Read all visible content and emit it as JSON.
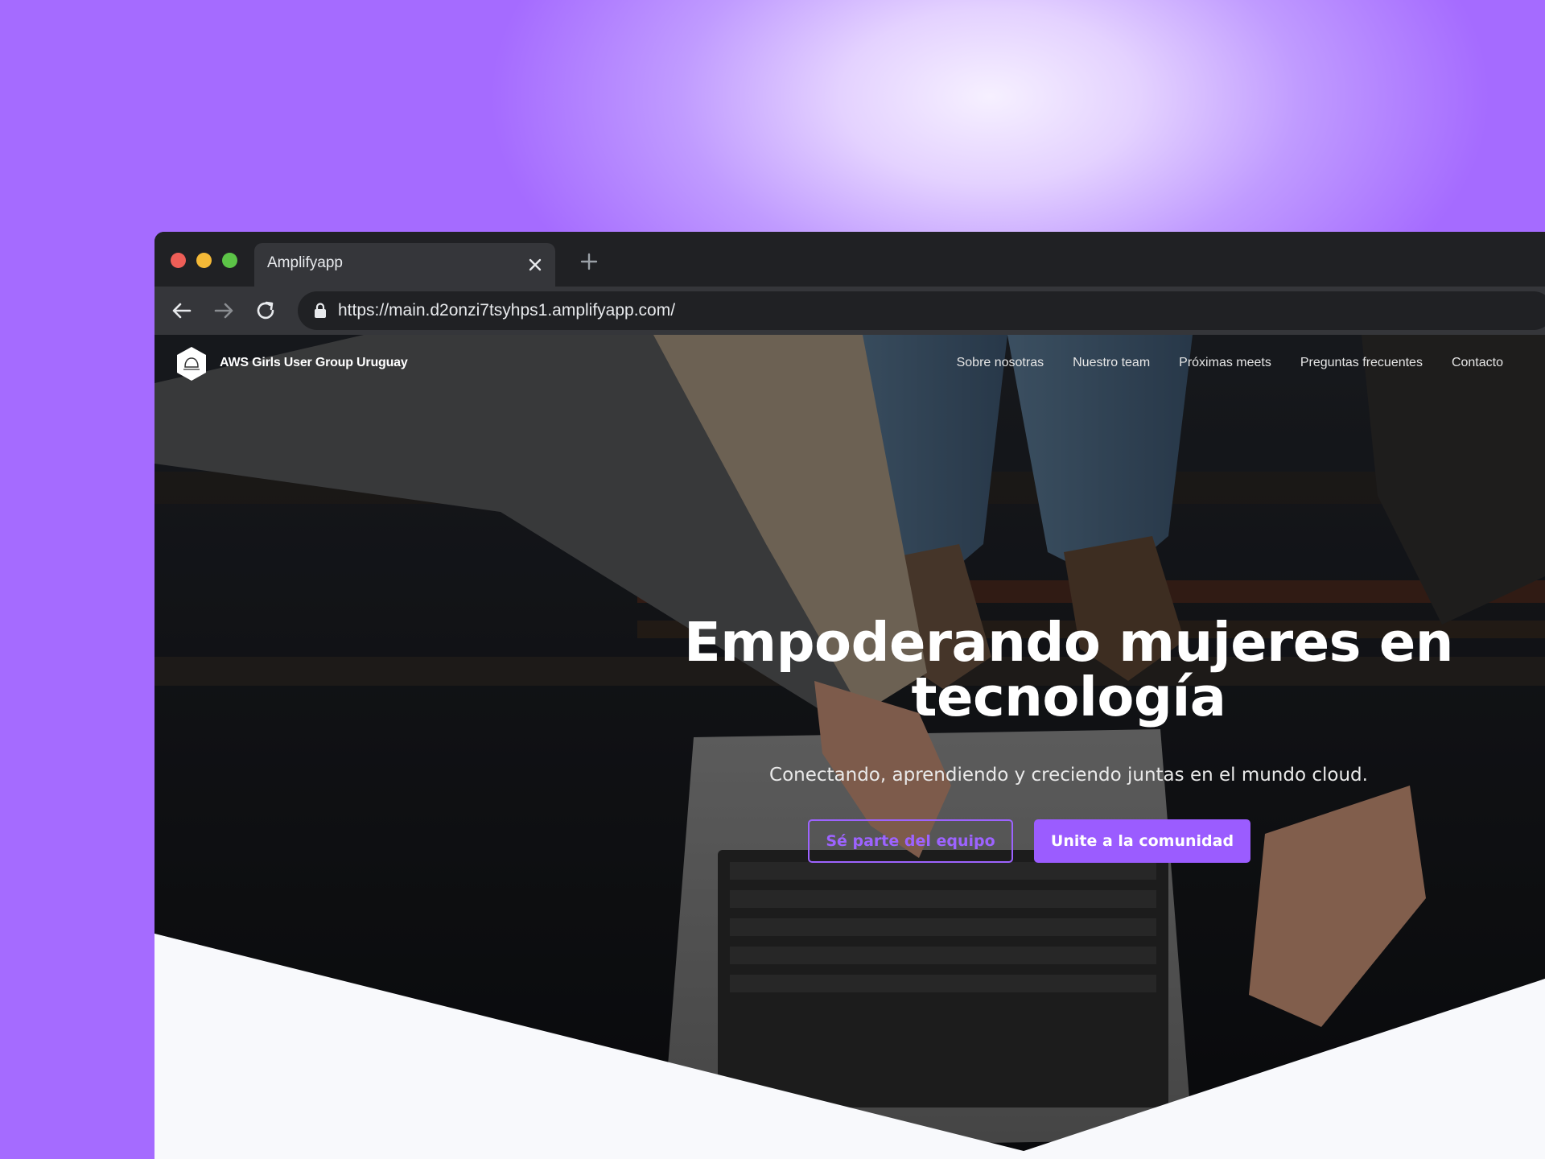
{
  "colors": {
    "accent": "#9b5cff",
    "browser_frame": "#202124",
    "toolbar": "#35363a"
  },
  "browser": {
    "window_controls": [
      "close",
      "minimize",
      "maximize"
    ],
    "tab": {
      "title": "Amplifyapp",
      "close_icon": "close-icon"
    },
    "new_tab_icon": "plus-icon",
    "nav_icons": [
      "back-arrow-icon",
      "forward-arrow-icon",
      "reload-icon"
    ],
    "url": "https://main.d2onzi7tsyhps1.amplifyapp.com/",
    "secure_icon": "lock-icon"
  },
  "site": {
    "logo_name": "AWS Girls User Group Uruguay",
    "logo_icon": "hexagon-logo-icon",
    "nav": [
      {
        "label": "Sobre nosotras"
      },
      {
        "label": "Nuestro team"
      },
      {
        "label": "Próximas meets"
      },
      {
        "label": "Preguntas frecuentes"
      },
      {
        "label": "Contacto"
      }
    ],
    "hero": {
      "title_line1": "Empoderando mujeres en",
      "title_line2": "tecnología",
      "subtitle": "Conectando, aprendiendo y creciendo juntas en el mundo cloud.",
      "primary_button": "Unite a la comunidad",
      "secondary_button": "Sé parte del equipo"
    }
  }
}
